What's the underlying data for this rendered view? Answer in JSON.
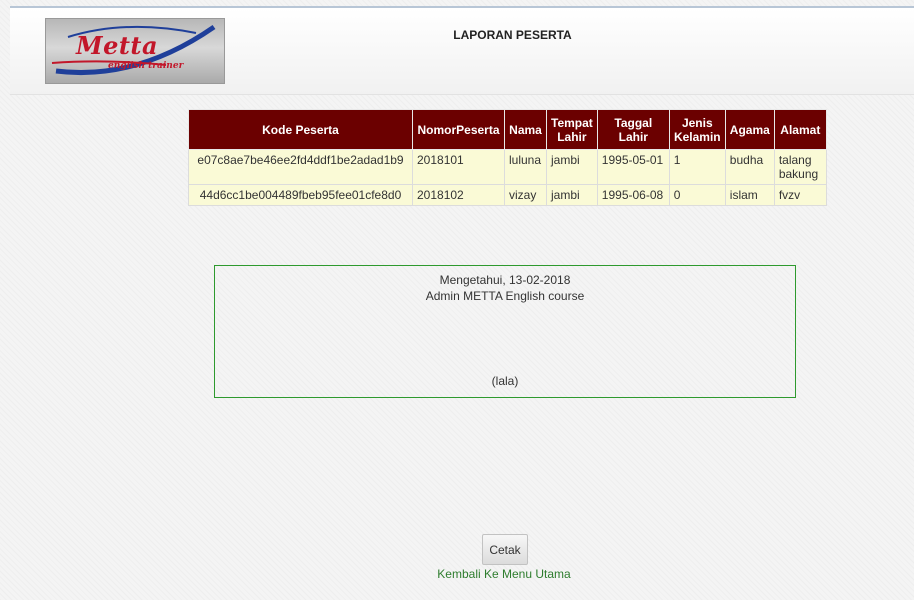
{
  "header": {
    "logo_text": "Metta",
    "logo_subtext": "english trainer",
    "title": "LAPORAN PESERTA"
  },
  "table": {
    "columns": [
      "Kode Peserta",
      "NomorPeserta",
      "Nama",
      "Tempat Lahir",
      "Taggal Lahir",
      "Jenis Kelamin",
      "Agama",
      "Alamat"
    ],
    "rows": [
      [
        "e07c8ae7be46ee2fd4ddf1be2adad1b9",
        "2018101",
        "luluna",
        "jambi",
        "1995-05-01",
        "1",
        "budha",
        "talang bakung"
      ],
      [
        "44d6cc1be004489fbeb95fee01cfe8d0",
        "2018102",
        "vizay",
        "jambi",
        "1995-06-08",
        "0",
        "islam",
        "fvzv"
      ]
    ]
  },
  "signature": {
    "line1": "Mengetahui, 13-02-2018",
    "line2": "Admin METTA English course",
    "name": "(lala)"
  },
  "actions": {
    "print_label": "Cetak",
    "back_label": "Kembali Ke Menu Utama"
  },
  "colors": {
    "table_header_bg": "#6b0000",
    "table_row_bg": "#fafad6",
    "border_green": "#2e9a2e",
    "link_green": "#2e7d2e"
  }
}
